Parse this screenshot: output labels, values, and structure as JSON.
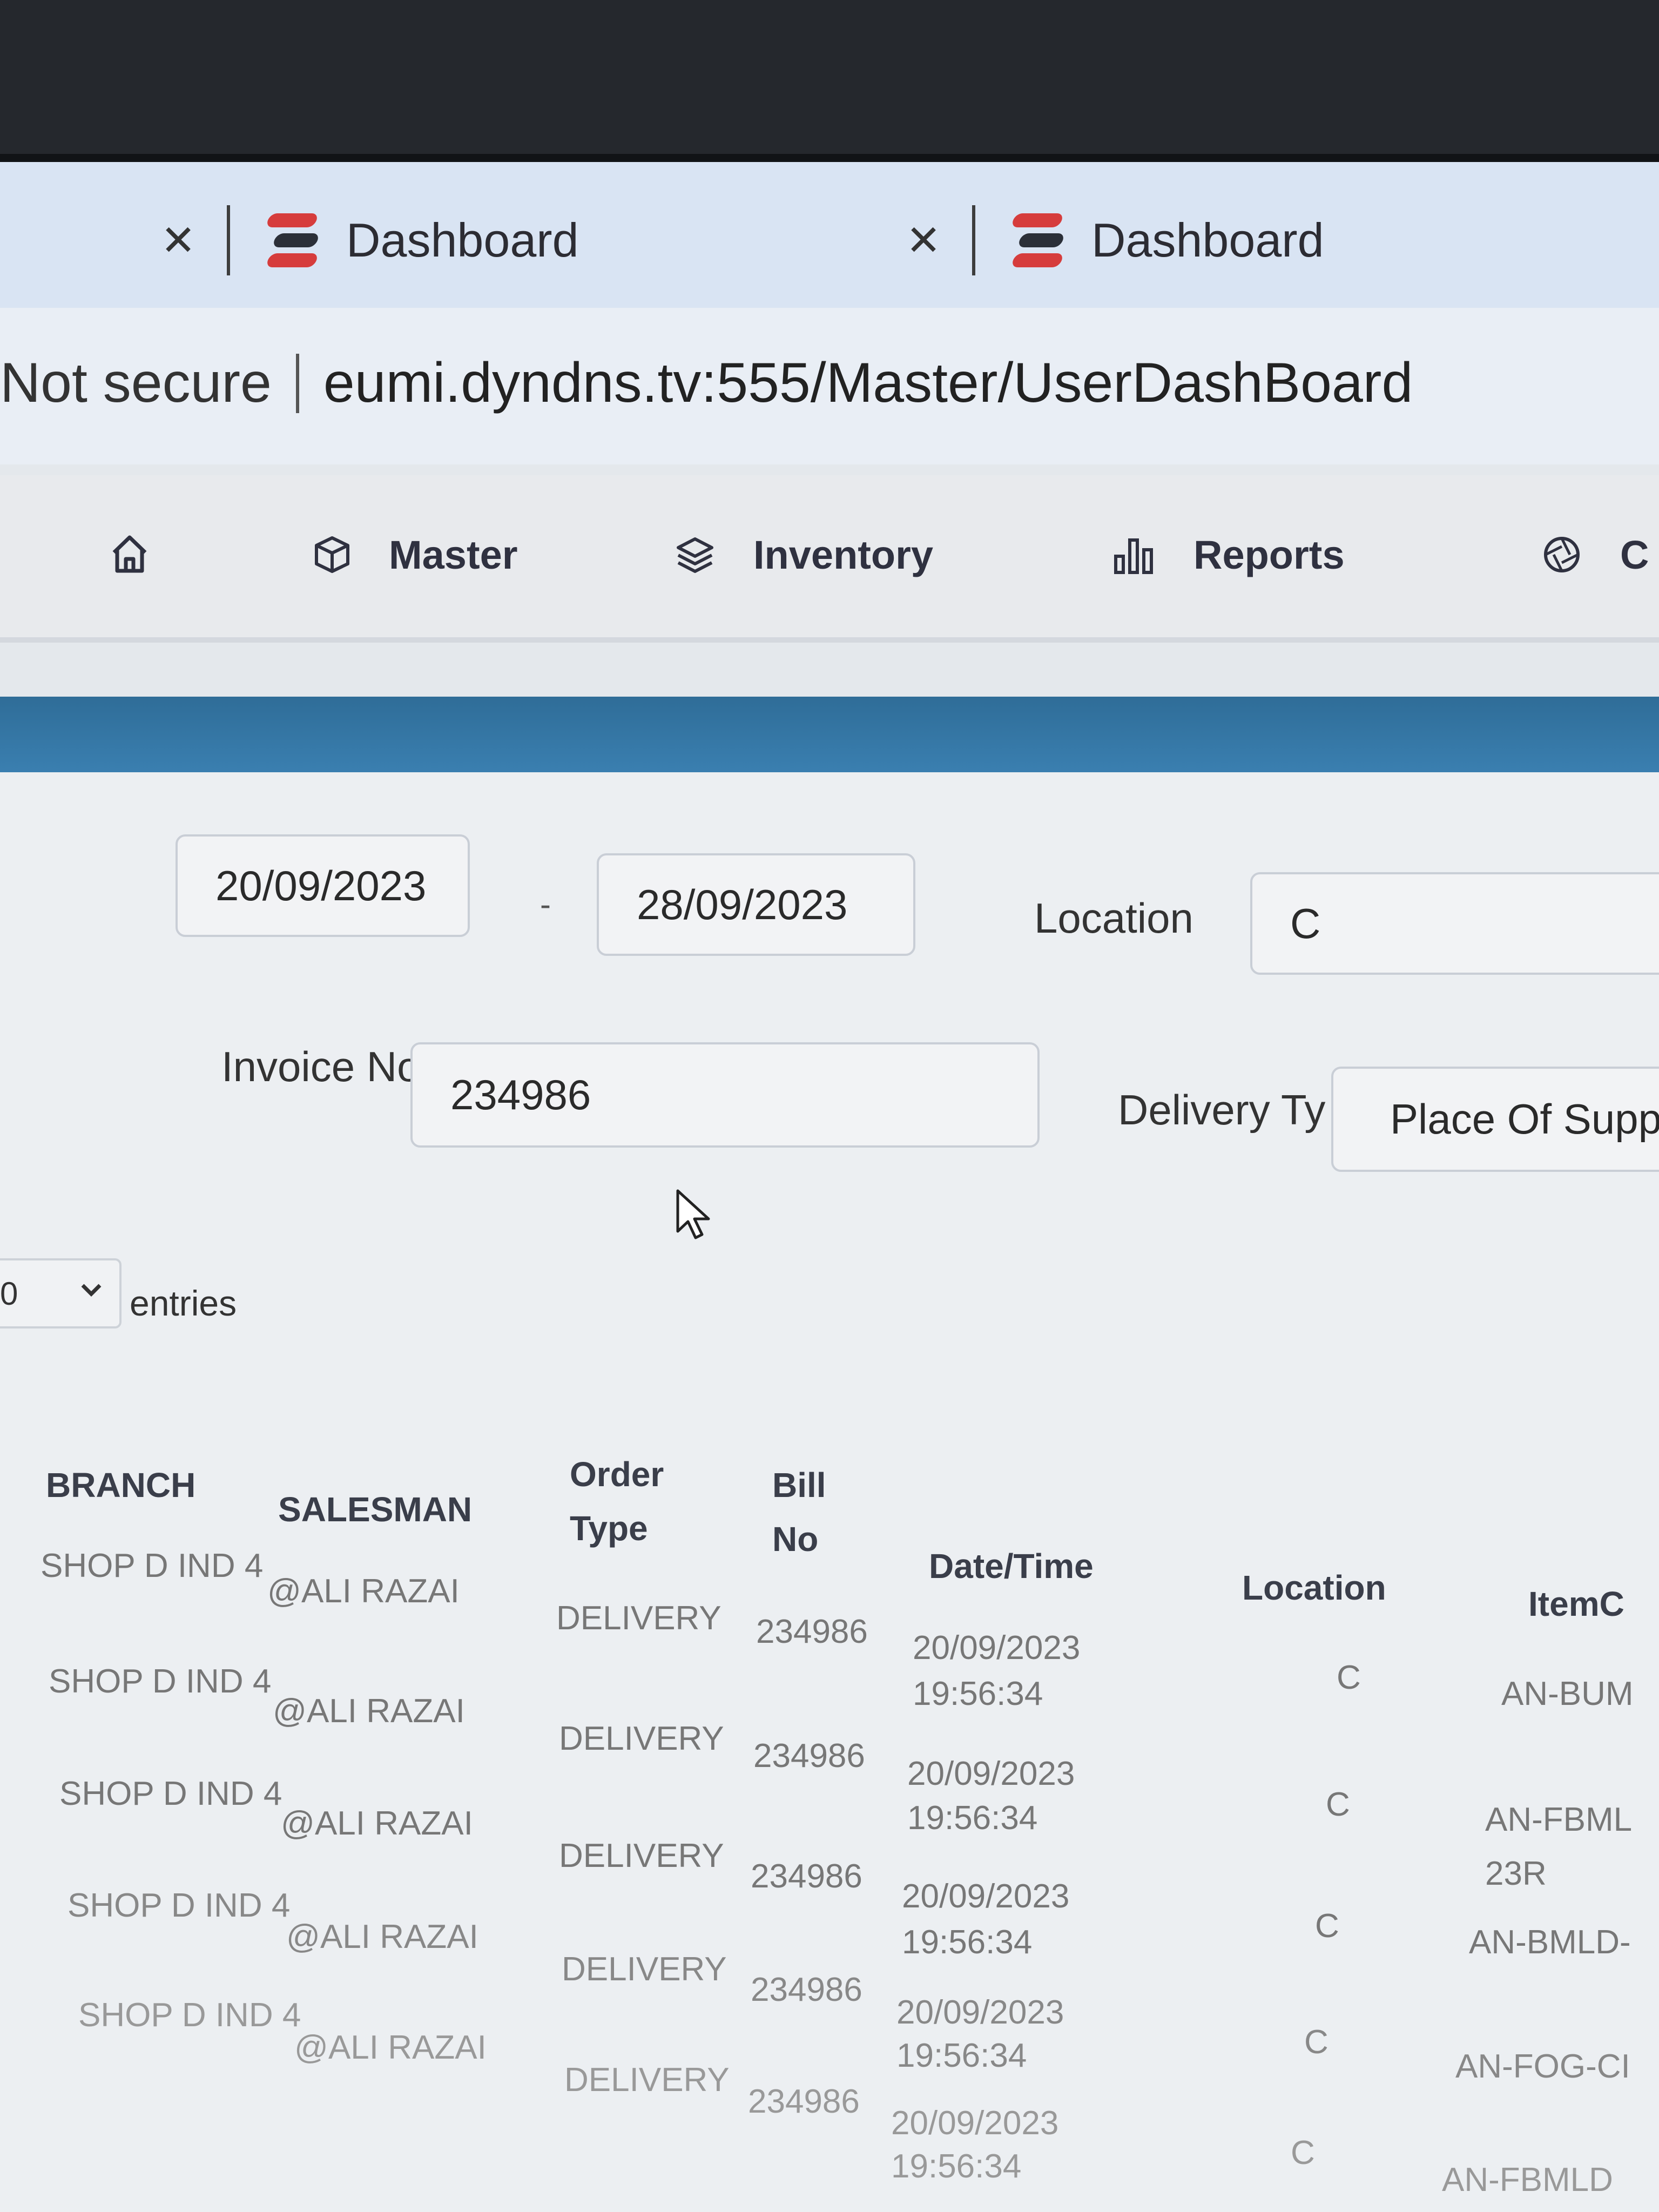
{
  "browser": {
    "tabs": [
      {
        "title": "Dashboard"
      },
      {
        "title": "Dashboard"
      }
    ],
    "security_label": "Not secure",
    "url": "eumi.dyndns.tv:555/Master/UserDashBoard"
  },
  "nav": {
    "items": [
      {
        "label": "",
        "icon": "home-icon"
      },
      {
        "label": "Master",
        "icon": "cube-icon"
      },
      {
        "label": "Inventory",
        "icon": "layers-icon"
      },
      {
        "label": "Reports",
        "icon": "bar-chart-icon"
      },
      {
        "label": "C",
        "icon": "aperture-icon"
      }
    ]
  },
  "filters": {
    "date_from": "20/09/2023",
    "date_separator": "-",
    "date_to": "28/09/2023",
    "location_label": "Location",
    "location_value": "C",
    "invoice_label": "Invoice No",
    "invoice_value": "234986",
    "delivery_label": "Delivery Ty",
    "delivery_value": "Place Of Supp"
  },
  "entries": {
    "value": "0",
    "label": "entries"
  },
  "table": {
    "headers": {
      "branch": "BRANCH",
      "salesman": "SALESMAN",
      "order_type_1": "Order",
      "order_type_2": "Type",
      "bill_no_1": "Bill",
      "bill_no_2": "No",
      "datetime": "Date/Time",
      "location": "Location",
      "item": "ItemC"
    },
    "rows": [
      {
        "branch": "SHOP D IND 4",
        "salesman": "@ALI RAZAI",
        "order_type": "DELIVERY",
        "bill_no": "234986",
        "date": "20/09/2023",
        "time": "19:56:34",
        "location": "C",
        "item": "AN-BUM",
        "item2": ""
      },
      {
        "branch": "SHOP D IND 4",
        "salesman": "@ALI RAZAI",
        "order_type": "DELIVERY",
        "bill_no": "234986",
        "date": "20/09/2023",
        "time": "19:56:34",
        "location": "C",
        "item": "AN-FBML",
        "item2": "23R"
      },
      {
        "branch": "SHOP D IND 4",
        "salesman": "@ALI RAZAI",
        "order_type": "DELIVERY",
        "bill_no": "234986",
        "date": "20/09/2023",
        "time": "19:56:34",
        "location": "C",
        "item": "AN-BMLD-",
        "item2": ""
      },
      {
        "branch": "SHOP D IND 4",
        "salesman": "@ALI RAZAI",
        "order_type": "DELIVERY",
        "bill_no": "234986",
        "date": "20/09/2023",
        "time": "19:56:34",
        "location": "C",
        "item": "AN-FOG-CI",
        "item2": ""
      },
      {
        "branch": "SHOP D IND 4",
        "salesman": "@ALI RAZAI",
        "order_type": "DELIVERY",
        "bill_no": "234986",
        "date": "20/09/2023",
        "time": "19:56:34",
        "location": "C",
        "item": "AN-FBMLD",
        "item2": ""
      }
    ]
  },
  "colors": {
    "accent_band": "#3a7fb0",
    "logo_red": "#d63c3c",
    "tab_bar": "#d9e4f3"
  }
}
